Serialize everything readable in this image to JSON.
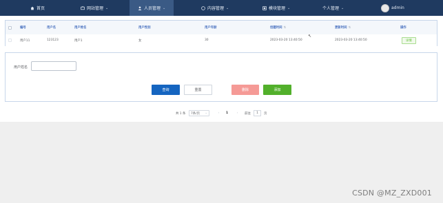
{
  "nav": {
    "items": [
      {
        "label": "首页",
        "icon": "home-icon"
      },
      {
        "label": "网站管理",
        "icon": "tv-icon"
      },
      {
        "label": "人员管理",
        "icon": "user-icon"
      },
      {
        "label": "内容管理",
        "icon": "chat-icon"
      },
      {
        "label": "模块管理",
        "icon": "module-icon"
      },
      {
        "label": "个人管理",
        "icon": "none"
      }
    ],
    "user": "admin"
  },
  "table": {
    "columns": [
      "编号",
      "用户名",
      "用户姓名",
      "用户性别",
      "用户年龄",
      "创建时间",
      "更新时间",
      "操作"
    ],
    "rows": [
      {
        "id": "用户11",
        "username": "123123",
        "name": "用户1",
        "gender": "女",
        "age": "30",
        "created": "2023-03-20 13:40:50",
        "updated": "2023-03-20 13:40:50",
        "action": "详情"
      }
    ]
  },
  "form": {
    "name_label": "用户姓名",
    "name_value": "",
    "buttons": {
      "query": "查询",
      "reset": "重置",
      "delete": "删除",
      "add": "添加"
    }
  },
  "pager": {
    "total_text": "共 1 条",
    "page_size": "7条/页",
    "prev": "‹",
    "current": "1",
    "next": "›",
    "goto_label": "前往",
    "goto_value": "1",
    "page_suffix": "页"
  },
  "watermark": "CSDN @MZ_ZXD001",
  "colors": {
    "navbar": "#1f3a60",
    "primary": "#1565c0",
    "danger": "#f59a96",
    "success": "#52b02b"
  }
}
